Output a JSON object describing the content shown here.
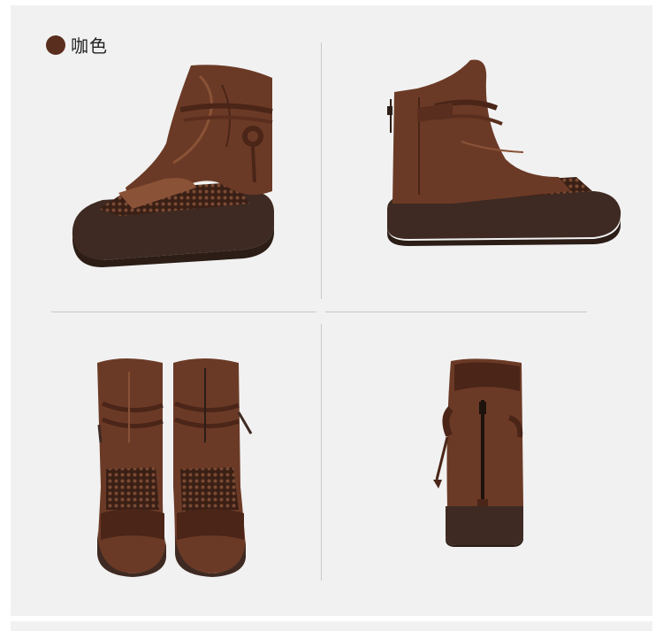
{
  "color_option": {
    "label": "咖色",
    "swatch_color": "#5a2e1e"
  },
  "colors": {
    "panel_bg": "#f1f1f1",
    "leather": "#6b3a26",
    "leather_light": "#8a5236",
    "leather_dark": "#4a2518",
    "sole": "#3e2a22",
    "sole_dark": "#2c1d17",
    "divider": "#c9c9c9"
  },
  "views": [
    {
      "name": "side-view-left"
    },
    {
      "name": "side-view-right"
    },
    {
      "name": "front-view-pair"
    },
    {
      "name": "back-view"
    }
  ]
}
